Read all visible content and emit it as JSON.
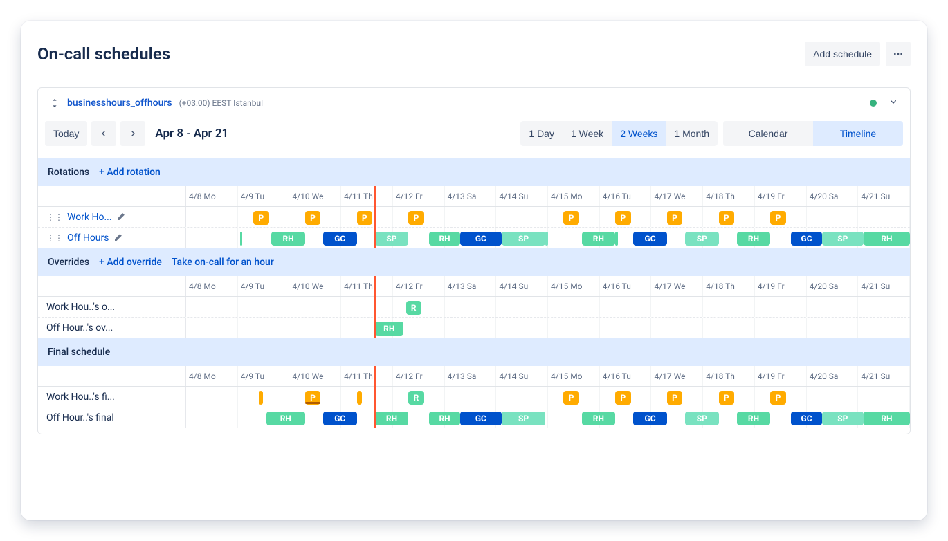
{
  "page": {
    "title": "On-call schedules"
  },
  "header_actions": {
    "add_schedule": "Add schedule"
  },
  "schedule": {
    "name": "businesshours_offhours",
    "timezone": "(+03:00) EEST Istanbul"
  },
  "toolbar": {
    "today": "Today",
    "date_range": "Apr 8 - Apr 21",
    "ranges": [
      {
        "label": "1 Day",
        "active": false
      },
      {
        "label": "1 Week",
        "active": false
      },
      {
        "label": "2 Weeks",
        "active": true
      },
      {
        "label": "1 Month",
        "active": false
      }
    ],
    "views": [
      {
        "label": "Calendar",
        "active": false
      },
      {
        "label": "Timeline",
        "active": true
      }
    ]
  },
  "days": [
    "4/8 Mo",
    "4/9 Tu",
    "4/10 We",
    "4/11 Th",
    "4/12 Fr",
    "4/13 Sa",
    "4/14 Su",
    "4/15 Mo",
    "4/16 Tu",
    "4/17 We",
    "4/18 Th",
    "4/19 Fr",
    "4/20 Sa",
    "4/21 Su"
  ],
  "sections": {
    "rotations": {
      "title": "Rotations",
      "add_link": "+ Add rotation",
      "rows": [
        {
          "label": "Work Ho...",
          "linked": true,
          "blocks": [
            {
              "txt": "P",
              "start": 1.3,
              "width": 0.3,
              "color": "P"
            },
            {
              "txt": "P",
              "start": 2.3,
              "width": 0.3,
              "color": "P"
            },
            {
              "txt": "P",
              "start": 3.3,
              "width": 0.3,
              "color": "P"
            },
            {
              "txt": "P",
              "start": 4.3,
              "width": 0.3,
              "color": "P"
            },
            {
              "txt": "P",
              "start": 7.3,
              "width": 0.3,
              "color": "P"
            },
            {
              "txt": "P",
              "start": 8.3,
              "width": 0.3,
              "color": "P"
            },
            {
              "txt": "P",
              "start": 9.3,
              "width": 0.3,
              "color": "P"
            },
            {
              "txt": "P",
              "start": 10.3,
              "width": 0.3,
              "color": "P"
            },
            {
              "txt": "P",
              "start": 11.3,
              "width": 0.3,
              "color": "P"
            }
          ]
        },
        {
          "label": "Off Hours",
          "linked": true,
          "blocks": [
            {
              "txt": "",
              "start": 1.05,
              "width": 0.04,
              "color": "RH"
            },
            {
              "txt": "RH",
              "start": 1.65,
              "width": 0.65,
              "color": "RH"
            },
            {
              "txt": "GC",
              "start": 2.65,
              "width": 0.65,
              "color": "GC"
            },
            {
              "txt": "SP",
              "start": 3.65,
              "width": 0.65,
              "color": "SP"
            },
            {
              "txt": "RH",
              "start": 4.7,
              "width": 0.6,
              "color": "RH"
            },
            {
              "txt": "GC",
              "start": 5.3,
              "width": 0.8,
              "color": "GC"
            },
            {
              "txt": "SP",
              "start": 6.1,
              "width": 0.85,
              "color": "SP"
            },
            {
              "txt": "",
              "start": 6.95,
              "width": 0.05,
              "color": "SP"
            },
            {
              "txt": "RH",
              "start": 7.65,
              "width": 0.65,
              "color": "RH"
            },
            {
              "txt": "",
              "start": 8.3,
              "width": 0.05,
              "color": "RH"
            },
            {
              "txt": "GC",
              "start": 8.65,
              "width": 0.65,
              "color": "GC"
            },
            {
              "txt": "SP",
              "start": 9.65,
              "width": 0.65,
              "color": "SP"
            },
            {
              "txt": "RH",
              "start": 10.65,
              "width": 0.65,
              "color": "RH"
            },
            {
              "txt": "GC",
              "start": 11.7,
              "width": 0.6,
              "color": "GC"
            },
            {
              "txt": "SP",
              "start": 12.3,
              "width": 0.8,
              "color": "SP"
            },
            {
              "txt": "RH",
              "start": 13.1,
              "width": 0.9,
              "color": "RH"
            }
          ]
        }
      ]
    },
    "overrides": {
      "title": "Overrides",
      "add_link": "+ Add override",
      "take_link": "Take on-call for an hour",
      "rows": [
        {
          "label": "Work Hou..'s o...",
          "linked": false,
          "blocks": [
            {
              "txt": "R",
              "start": 4.25,
              "width": 0.3,
              "color": "R"
            }
          ]
        },
        {
          "label": "Off Hour..'s ov...",
          "linked": false,
          "blocks": [
            {
              "txt": "RH",
              "start": 3.65,
              "width": 0.55,
              "color": "RH"
            }
          ]
        }
      ]
    },
    "final": {
      "title": "Final schedule",
      "rows": [
        {
          "label": "Work Hou..'s fi...",
          "linked": false,
          "underscore_at": 2.3,
          "blocks": [
            {
              "txt": "",
              "start": 1.4,
              "width": 0.08,
              "color": "P"
            },
            {
              "txt": "P",
              "start": 2.3,
              "width": 0.3,
              "color": "P"
            },
            {
              "txt": "",
              "start": 3.3,
              "width": 0.1,
              "color": "P"
            },
            {
              "txt": "R",
              "start": 4.3,
              "width": 0.3,
              "color": "R"
            },
            {
              "txt": "P",
              "start": 7.3,
              "width": 0.3,
              "color": "P"
            },
            {
              "txt": "P",
              "start": 8.3,
              "width": 0.3,
              "color": "P"
            },
            {
              "txt": "P",
              "start": 9.3,
              "width": 0.3,
              "color": "P"
            },
            {
              "txt": "P",
              "start": 10.3,
              "width": 0.3,
              "color": "P"
            },
            {
              "txt": "P",
              "start": 11.3,
              "width": 0.3,
              "color": "P"
            }
          ]
        },
        {
          "label": "Off Hour..'s final",
          "linked": false,
          "blocks": [
            {
              "txt": "RH",
              "start": 1.55,
              "width": 0.75,
              "color": "RH"
            },
            {
              "txt": "GC",
              "start": 2.65,
              "width": 0.65,
              "color": "GC"
            },
            {
              "txt": "RH",
              "start": 3.65,
              "width": 0.65,
              "color": "RH"
            },
            {
              "txt": "RH",
              "start": 4.7,
              "width": 0.6,
              "color": "RH"
            },
            {
              "txt": "GC",
              "start": 5.3,
              "width": 0.8,
              "color": "GC"
            },
            {
              "txt": "SP",
              "start": 6.1,
              "width": 0.85,
              "color": "SP"
            },
            {
              "txt": "RH",
              "start": 7.65,
              "width": 0.65,
              "color": "RH"
            },
            {
              "txt": "GC",
              "start": 8.65,
              "width": 0.65,
              "color": "GC"
            },
            {
              "txt": "SP",
              "start": 9.65,
              "width": 0.65,
              "color": "SP"
            },
            {
              "txt": "RH",
              "start": 10.65,
              "width": 0.65,
              "color": "RH"
            },
            {
              "txt": "GC",
              "start": 11.7,
              "width": 0.6,
              "color": "GC"
            },
            {
              "txt": "SP",
              "start": 12.3,
              "width": 0.8,
              "color": "SP"
            },
            {
              "txt": "RH",
              "start": 13.1,
              "width": 0.9,
              "color": "RH"
            }
          ]
        }
      ]
    }
  },
  "colors": {
    "P": "#FFAB00",
    "RH": "#57D9A3",
    "GC": "#0052CC",
    "SP": "#79E2C0",
    "R": "#57D9A3",
    "accent_blue": "#0052CC",
    "now_line": "#FF5630"
  }
}
